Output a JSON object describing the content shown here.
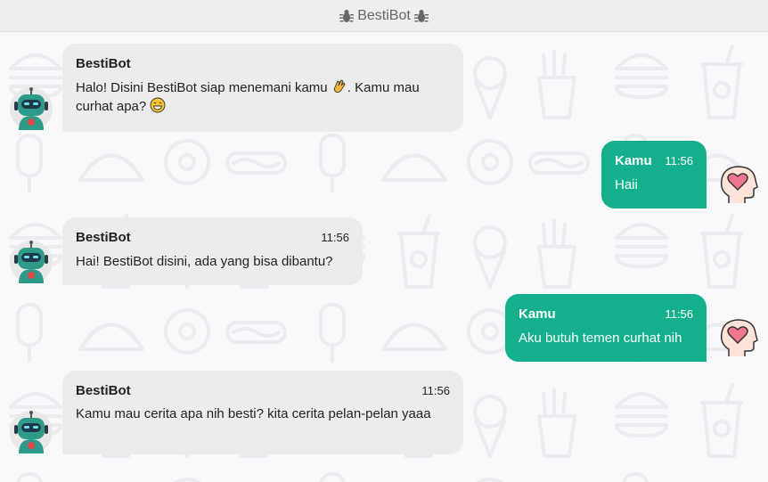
{
  "header": {
    "title": "BestiBot",
    "left_icon": "bug-icon",
    "right_icon": "bug-icon"
  },
  "bot": {
    "name": "BestiBot",
    "avatar_icon": "robot-icon"
  },
  "user": {
    "name": "Kamu",
    "avatar_icon": "heart-head-icon"
  },
  "messages": [
    {
      "side": "bot",
      "name": "BestiBot",
      "time": "",
      "text": "Halo! Disini BestiBot siap menemani kamu",
      "text_after": ". Kamu mau curhat apa?",
      "emojis": [
        "waving-hand-emoji",
        "grinning-face-emoji"
      ]
    },
    {
      "side": "user",
      "name": "Kamu",
      "time": "11:56",
      "text": "Haii"
    },
    {
      "side": "bot",
      "name": "BestiBot",
      "time": "11:56",
      "text": "Hai! BestiBot disini, ada yang bisa dibantu?"
    },
    {
      "side": "user",
      "name": "Kamu",
      "time": "11:56",
      "text": "Aku butuh temen curhat nih"
    },
    {
      "side": "bot",
      "name": "BestiBot",
      "time": "11:56",
      "text": "Kamu mau cerita apa nih besti? kita cerita pelan-pelan yaaa"
    }
  ],
  "colors": {
    "bot_bubble": "#ececec",
    "user_bubble": "#14b08d",
    "header_bg": "#eeeeee"
  }
}
